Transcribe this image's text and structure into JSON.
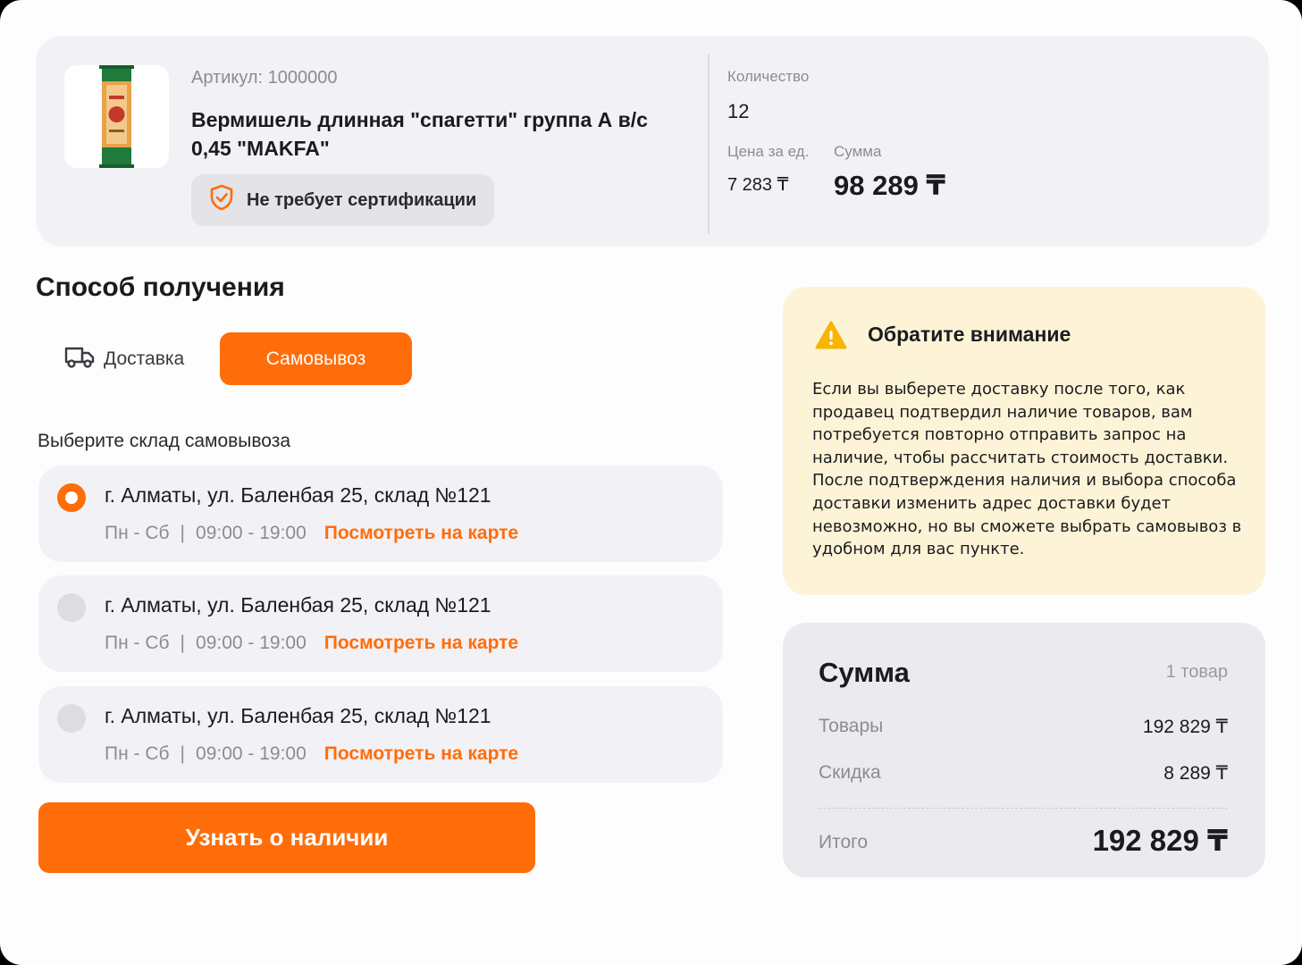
{
  "product": {
    "sku": "Артикул: 1000000",
    "name": "Вермишель длинная \"спагетти\" группа А в/с 0,45 \"MAKFA\"",
    "certification": "Не требует сертификации",
    "quantity_label": "Количество",
    "quantity_value": "12",
    "unit_price_label": "Цена за ед.",
    "unit_price_value": "7 283 ₸",
    "sum_label": "Сумма",
    "sum_value": "98 289 ₸"
  },
  "receiving": {
    "title": "Способ получения",
    "tabs": [
      {
        "label": "Доставка",
        "icon": "truck-icon",
        "active": false
      },
      {
        "label": "Самовывоз",
        "active": true
      }
    ],
    "warehouse_prompt": "Выберите склад самовывоза",
    "warehouses": [
      {
        "address": "г. Алматы, ул. Баленбая 25, склад №121",
        "days": "Пн - Сб",
        "hours": "09:00 - 19:00",
        "map_link": "Посмотреть на карте",
        "selected": true
      },
      {
        "address": "г. Алматы, ул. Баленбая 25, склад №121",
        "days": "Пн - Сб",
        "hours": "09:00 - 19:00",
        "map_link": "Посмотреть на карте",
        "selected": false
      },
      {
        "address": "г. Алматы, ул. Баленбая 25, склад №121",
        "days": "Пн - Сб",
        "hours": "09:00 - 19:00",
        "map_link": "Посмотреть на карте",
        "selected": false
      }
    ],
    "check_button": "Узнать о наличии"
  },
  "notice": {
    "icon": "warning-icon",
    "title": "Обратите внимание",
    "text": "Если вы выберете доставку после того, как продавец подтвердил наличие товаров, вам потребуется повторно отправить запрос на наличие, чтобы рассчитать стоимость доставки. После подтверждения наличия и выбора способа доставки изменить адрес доставки будет невозможно, но вы сможете выбрать самовывоз в удобном для вас пункте."
  },
  "summary": {
    "title": "Сумма",
    "count": "1 товар",
    "goods_label": "Товары",
    "goods_value": "192 829 ₸",
    "discount_label": "Скидка",
    "discount_value": "8 289 ₸",
    "total_label": "Итого",
    "total_value": "192 829 ₸"
  },
  "colors": {
    "accent": "#ff6d0a",
    "card_bg": "#f2f2f6",
    "notice_bg": "#fdf3d6",
    "warning_yellow": "#f7b500"
  }
}
